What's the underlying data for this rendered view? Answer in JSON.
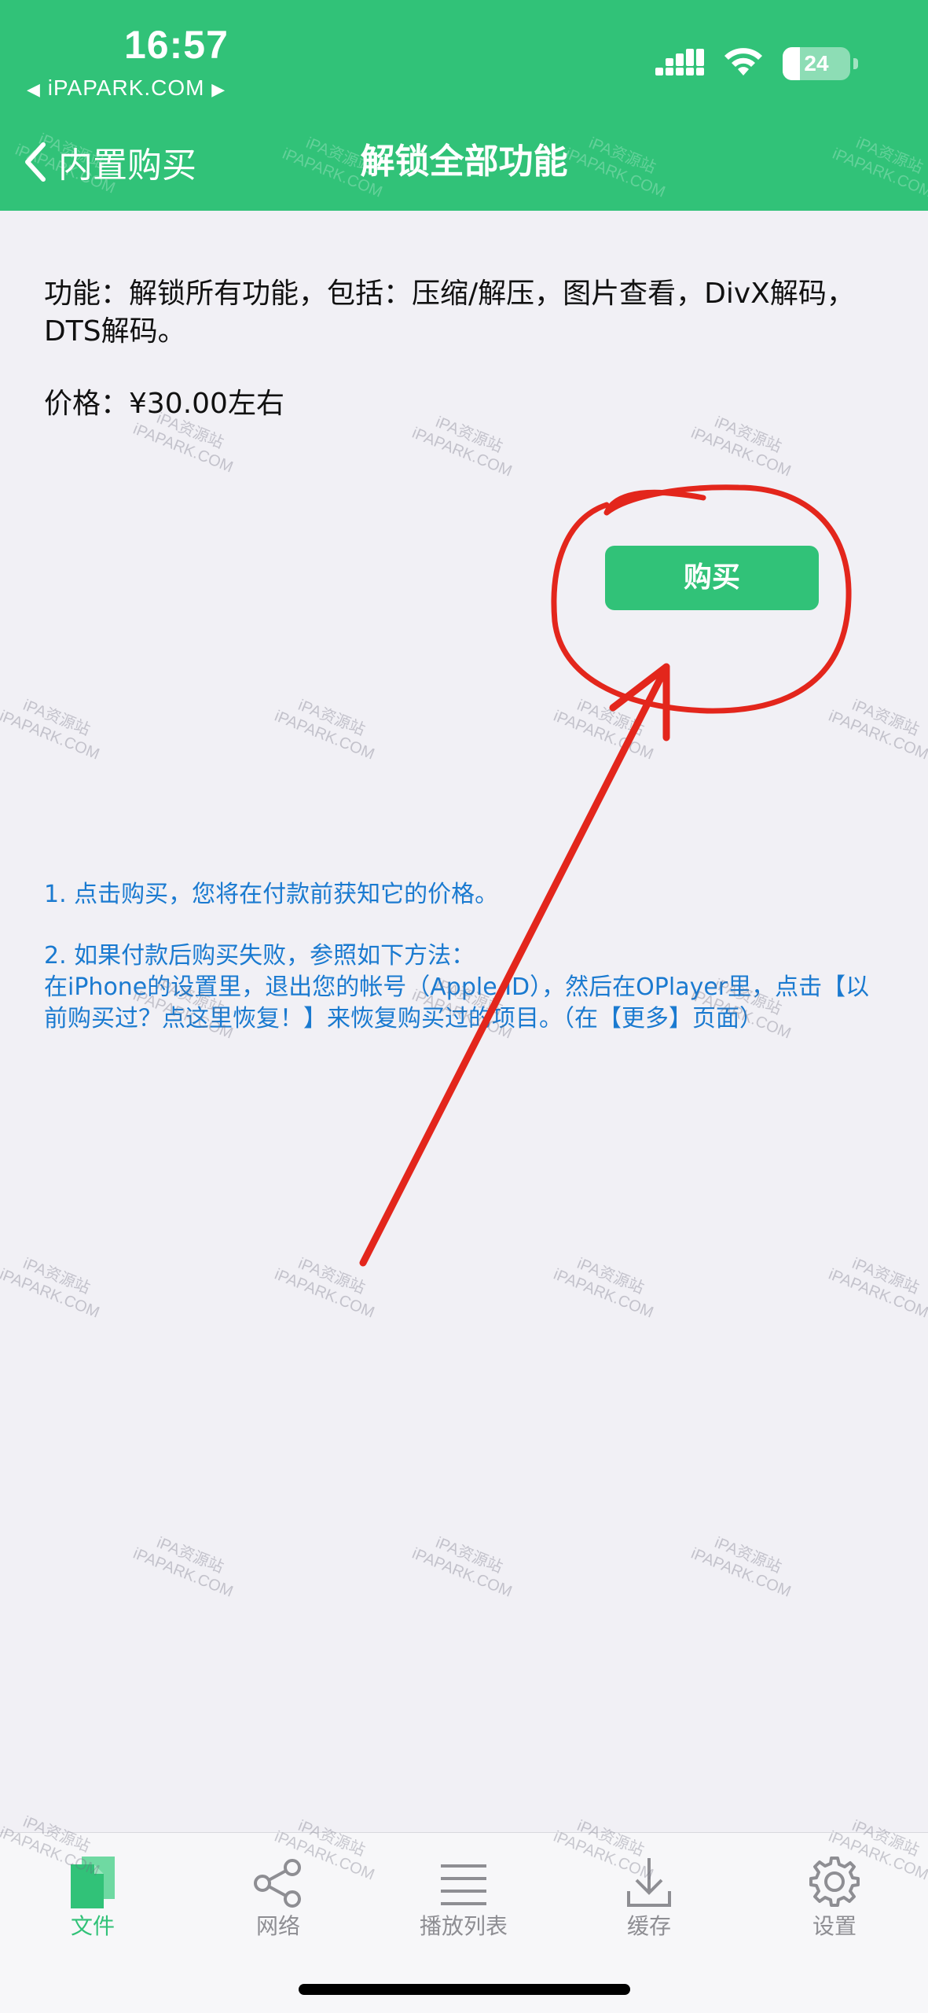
{
  "status_bar": {
    "time": "16:57",
    "carrier": "iPAPARK.COM",
    "battery_pct": "24"
  },
  "nav": {
    "back_label": "内置购买",
    "title": "解锁全部功能"
  },
  "content": {
    "feature_text": "功能：解锁所有功能，包括：压缩/解压，图片查看，DivX解码，DTS解码。",
    "price_text": "价格：¥30.00左右",
    "buy_label": "购买",
    "notes": [
      "1. 点击购买，您将在付款前获知它的价格。",
      "2. 如果付款后购买失败，参照如下方法：",
      "在iPhone的设置里，退出您的帐号（Apple ID），然后在OPlayer里，点击【以前购买过？点这里恢复！】来恢复购买过的项目。（在【更多】页面）"
    ]
  },
  "watermark": {
    "line1": "iPA资源站",
    "line2": "iPAPARK.COM"
  },
  "tabbar": {
    "tabs": [
      {
        "label": "文件",
        "icon": "file-icon",
        "active": true
      },
      {
        "label": "网络",
        "icon": "share-icon",
        "active": false
      },
      {
        "label": "播放列表",
        "icon": "list-icon",
        "active": false
      },
      {
        "label": "缓存",
        "icon": "download-icon",
        "active": false
      },
      {
        "label": "设置",
        "icon": "gear-icon",
        "active": false
      }
    ]
  },
  "colors": {
    "brand_green": "#31c278",
    "note_blue": "#1a7ad0",
    "annotation_red": "#e3261c",
    "background": "#f1f0f5"
  }
}
